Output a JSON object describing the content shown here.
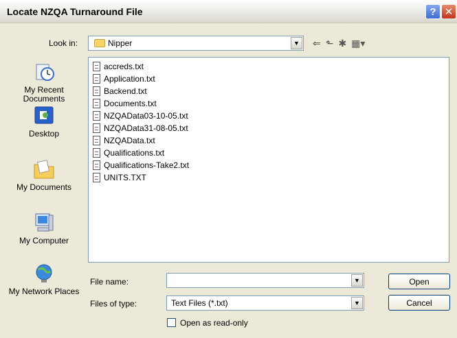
{
  "window": {
    "title": "Locate NZQA Turnaround File",
    "help_glyph": "?",
    "close_glyph": "✕"
  },
  "lookin": {
    "label": "Look in:",
    "value": "Nipper"
  },
  "toolbar": {
    "back_glyph": "⇐",
    "up_glyph": "⬑",
    "newfolder_glyph": "✱",
    "views_glyph": "▦▾"
  },
  "places": [
    {
      "label": "My Recent Documents",
      "icon": "recent-documents-icon"
    },
    {
      "label": "Desktop",
      "icon": "desktop-icon"
    },
    {
      "label": "My Documents",
      "icon": "my-documents-icon"
    },
    {
      "label": "My Computer",
      "icon": "my-computer-icon"
    },
    {
      "label": "My Network Places",
      "icon": "network-places-icon"
    }
  ],
  "files": [
    "accreds.txt",
    "Application.txt",
    "Backend.txt",
    "Documents.txt",
    "NZQAData03-10-05.txt",
    "NZQAData31-08-05.txt",
    "NZQAData.txt",
    "Qualifications.txt",
    "Qualifications-Take2.txt",
    "UNITS.TXT"
  ],
  "filename": {
    "label": "File name:",
    "value": ""
  },
  "filetype": {
    "label": "Files of type:",
    "value": "Text Files (*.txt)"
  },
  "readonly": {
    "label": "Open as read-only",
    "checked": false
  },
  "buttons": {
    "open": "Open",
    "cancel": "Cancel"
  },
  "colors": {
    "titlebar": "#ece9d8",
    "help": "#3d6bd7",
    "close": "#c2341b",
    "field_border": "#7f9db9"
  }
}
